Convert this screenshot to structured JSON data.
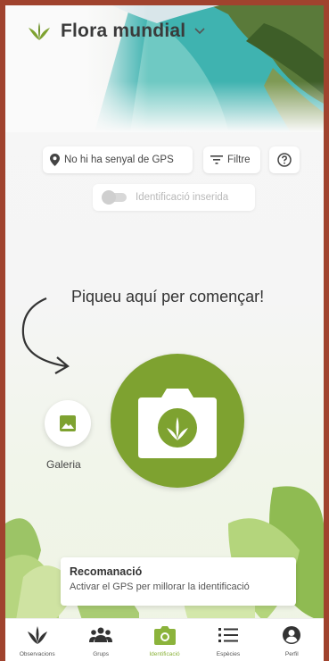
{
  "app": {
    "title": "Flora mundial"
  },
  "toolbar": {
    "gps_label": "No hi ha senyal de GPS",
    "filter_label": "Filtre"
  },
  "identification_toggle": {
    "label": "Identificació inserida",
    "enabled": false
  },
  "hint": {
    "text": "Piqueu aquí per començar!"
  },
  "gallery": {
    "label": "Galeria"
  },
  "recommendation": {
    "title": "Recomanació",
    "text": "Activar el GPS per millorar la identificació"
  },
  "bottom_nav": {
    "items": [
      {
        "label": "Observacions",
        "icon": "plant-icon"
      },
      {
        "label": "Grups",
        "icon": "people-icon"
      },
      {
        "label": "Identificació",
        "icon": "camera-icon",
        "active": true
      },
      {
        "label": "Espècies",
        "icon": "list-icon"
      },
      {
        "label": "Perfil",
        "icon": "profile-icon"
      }
    ]
  },
  "colors": {
    "accent": "#7ea230",
    "active_nav": "#8bb33b",
    "frame": "#a0432e"
  }
}
